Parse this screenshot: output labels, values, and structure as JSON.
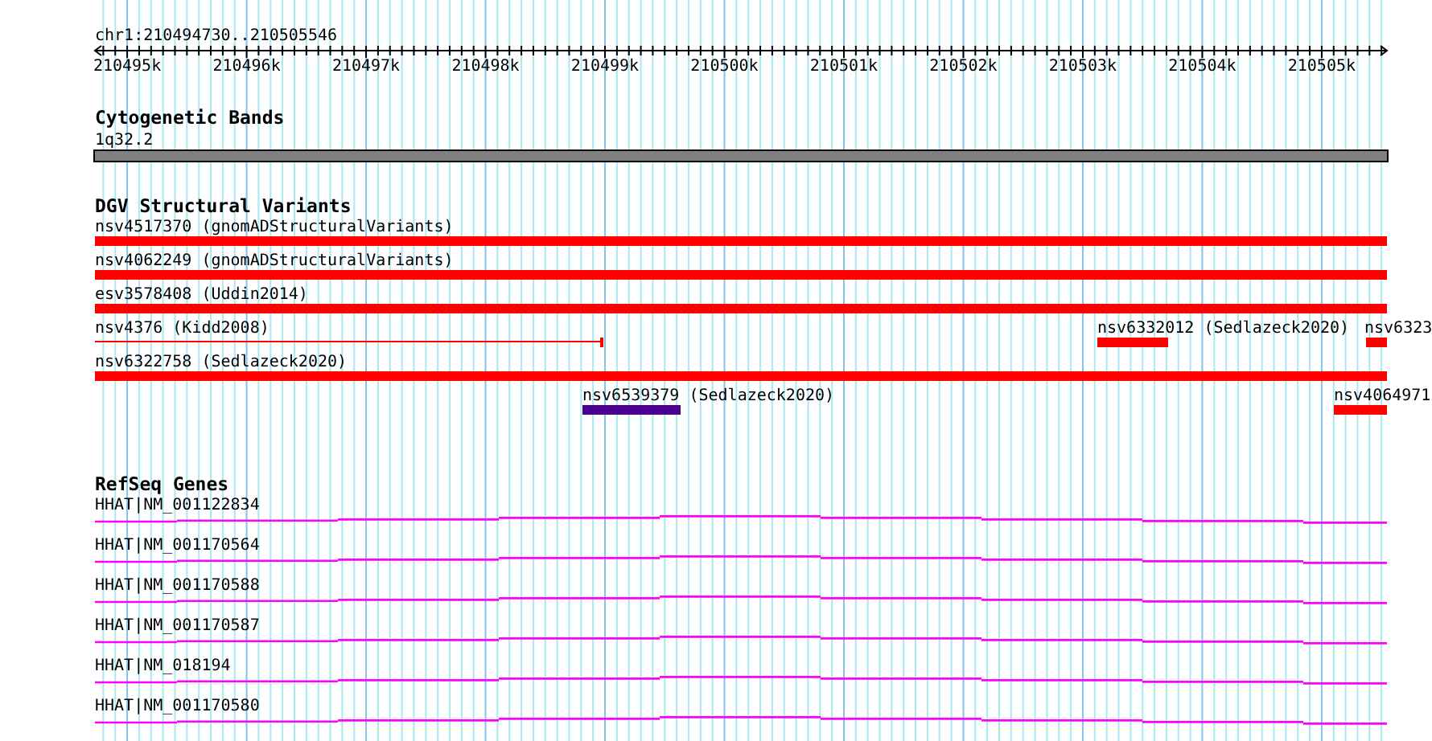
{
  "ruler": {
    "region": "chr1:210494730..210505546",
    "ticks": [
      "210495k",
      "210496k",
      "210497k",
      "210498k",
      "210499k",
      "210500k",
      "210501k",
      "210502k",
      "210503k",
      "210504k",
      "210505k"
    ]
  },
  "tracks": [
    {
      "title": "Cytogenetic Bands",
      "kind": "bands",
      "features": [
        {
          "label": "1q32.2"
        }
      ]
    },
    {
      "title": "DGV Structural Variants",
      "kind": "variants",
      "features": [
        {
          "label": "nsv4517370 (gnomADStructuralVariants)",
          "kind": "bar",
          "color": "#ff0000"
        },
        {
          "label": "nsv4062249 (gnomADStructuralVariants)",
          "kind": "bar",
          "color": "#ff0000"
        },
        {
          "label": "esv3578408 (Uddin2014)",
          "kind": "bar",
          "color": "#ff0000"
        },
        {
          "label": "nsv4376 (Kidd2008)",
          "kind": "line",
          "color": "#ff0000"
        },
        {
          "label": "nsv6332012 (Sedlazeck2020)",
          "kind": "bar",
          "color": "#ff0000"
        },
        {
          "label": "nsv6323",
          "kind": "bar",
          "color": "#ff0000"
        },
        {
          "label": "nsv6322758 (Sedlazeck2020)",
          "kind": "bar",
          "color": "#ff0000"
        },
        {
          "label": "nsv6539379 (Sedlazeck2020)",
          "kind": "bar",
          "color": "#4b0090"
        },
        {
          "label": "nsv4064971",
          "kind": "bar",
          "color": "#ff0000"
        }
      ]
    },
    {
      "title": "RefSeq Genes",
      "kind": "genes",
      "features": [
        {
          "label": "HHAT|NM_001122834"
        },
        {
          "label": "HHAT|NM_001170564"
        },
        {
          "label": "HHAT|NM_001170588"
        },
        {
          "label": "HHAT|NM_001170587"
        },
        {
          "label": "HHAT|NM_018194"
        },
        {
          "label": "HHAT|NM_001170580"
        }
      ]
    }
  ]
}
